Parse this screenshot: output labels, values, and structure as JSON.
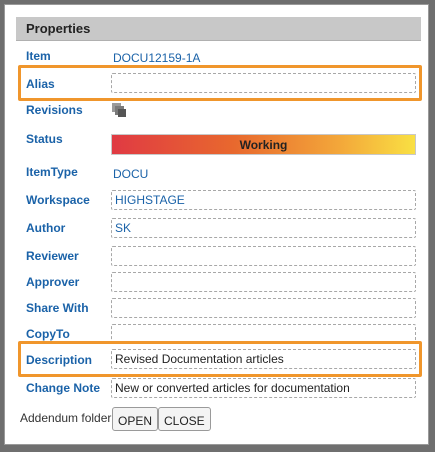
{
  "panel": {
    "title": "Properties"
  },
  "fields": {
    "item": {
      "label": "Item",
      "value": "DOCU12159-1A"
    },
    "alias": {
      "label": "Alias",
      "value": ""
    },
    "revisions": {
      "label": "Revisions",
      "icon": "stacked-pages-icon"
    },
    "status": {
      "label": "Status",
      "value": "Working"
    },
    "itemtype": {
      "label": "ItemType",
      "value": "DOCU"
    },
    "workspace": {
      "label": "Workspace",
      "value": "HIGHSTAGE"
    },
    "author": {
      "label": "Author",
      "value": "SK"
    },
    "reviewer": {
      "label": "Reviewer",
      "value": ""
    },
    "approver": {
      "label": "Approver",
      "value": ""
    },
    "sharewith": {
      "label": "Share With",
      "value": ""
    },
    "copyto": {
      "label": "CopyTo",
      "value": ""
    },
    "description": {
      "label": "Description",
      "value": "Revised Documentation articles"
    },
    "changenote": {
      "label": "Change Note",
      "value": "New or converted articles for documentation"
    }
  },
  "footer": {
    "text": "Addendum folder",
    "open_label": "OPEN",
    "close_label": "CLOSE"
  },
  "colors": {
    "accent_highlight": "#f0962c",
    "label_blue": "#1a62a8",
    "status_start": "#e03a43",
    "status_end": "#f9e043"
  }
}
